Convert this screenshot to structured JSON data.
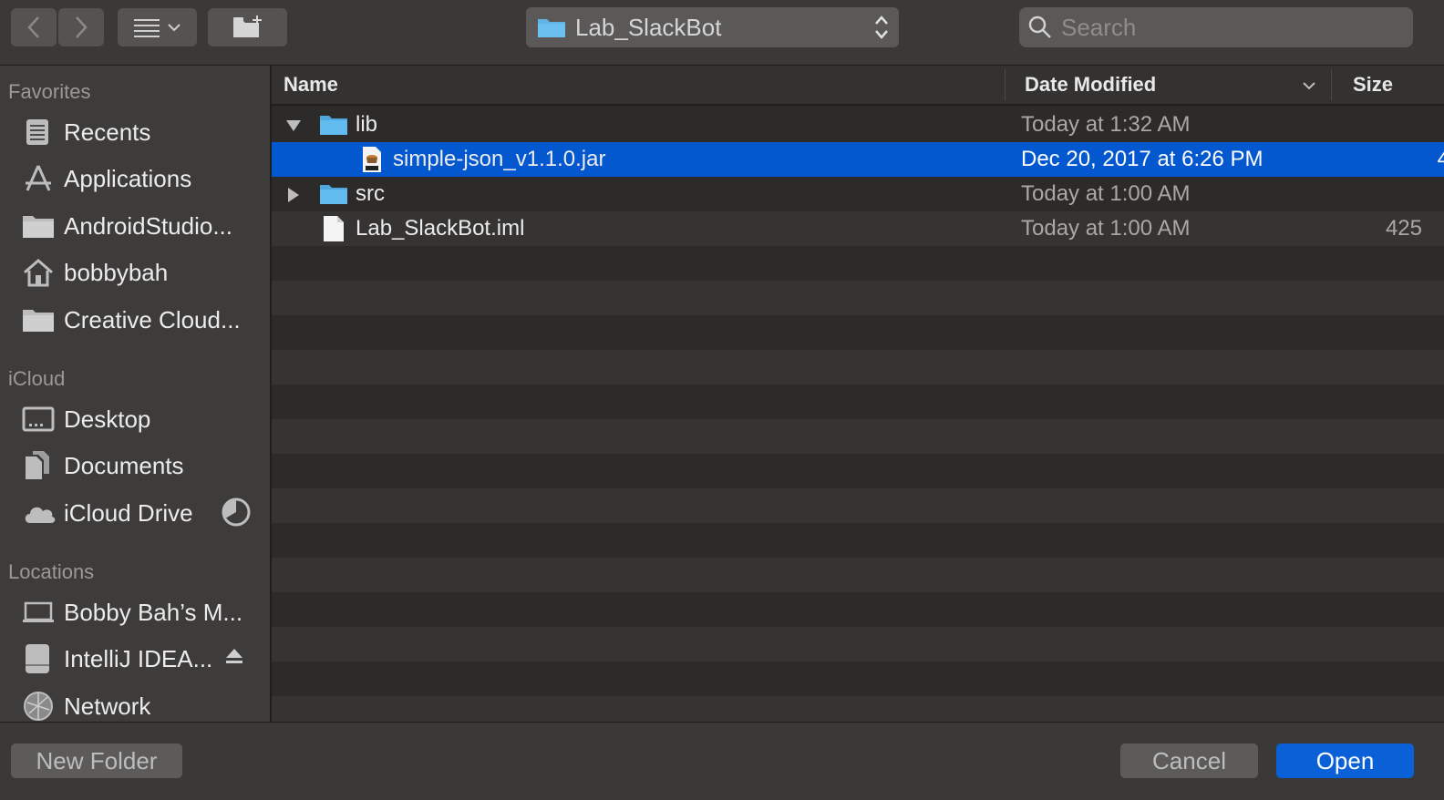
{
  "toolbar": {
    "location": "Lab_SlackBot",
    "search_placeholder": "Search"
  },
  "sidebar": {
    "sections": [
      {
        "title": "Favorites"
      },
      {
        "title": "iCloud"
      },
      {
        "title": "Locations"
      }
    ],
    "favorites": [
      {
        "label": "Recents",
        "icon": "recents-icon"
      },
      {
        "label": "Applications",
        "icon": "applications-icon"
      },
      {
        "label": "AndroidStudio...",
        "icon": "folder-icon"
      },
      {
        "label": "bobbybah",
        "icon": "home-icon"
      },
      {
        "label": "Creative Cloud...",
        "icon": "folder-icon"
      }
    ],
    "icloud": [
      {
        "label": "Desktop",
        "icon": "desktop-icon"
      },
      {
        "label": "Documents",
        "icon": "documents-icon"
      },
      {
        "label": "iCloud Drive",
        "icon": "cloud-icon"
      }
    ],
    "locations": [
      {
        "label": "Bobby Bah’s M...",
        "icon": "laptop-icon"
      },
      {
        "label": "IntelliJ IDEA...",
        "icon": "disk-icon"
      },
      {
        "label": "Network",
        "icon": "network-icon"
      }
    ]
  },
  "columns": {
    "name": "Name",
    "date_modified": "Date Modified",
    "size": "Size"
  },
  "files": [
    {
      "name": "lib",
      "type": "folder",
      "expanded": true,
      "date": "Today at 1:32 AM",
      "size": ""
    },
    {
      "name": "simple-json_v1.1.0.jar",
      "type": "jar",
      "date": "Dec 20, 2017 at 6:26 PM",
      "size": "4",
      "selected": true
    },
    {
      "name": "src",
      "type": "folder",
      "expanded": false,
      "date": "Today at 1:00 AM",
      "size": ""
    },
    {
      "name": "Lab_SlackBot.iml",
      "type": "file",
      "date": "Today at 1:00 AM",
      "size": "425"
    }
  ],
  "buttons": {
    "new_folder": "New Folder",
    "cancel": "Cancel",
    "open": "Open"
  },
  "colors": {
    "accent": "#0458cf",
    "folder": "#5fb3e6"
  }
}
